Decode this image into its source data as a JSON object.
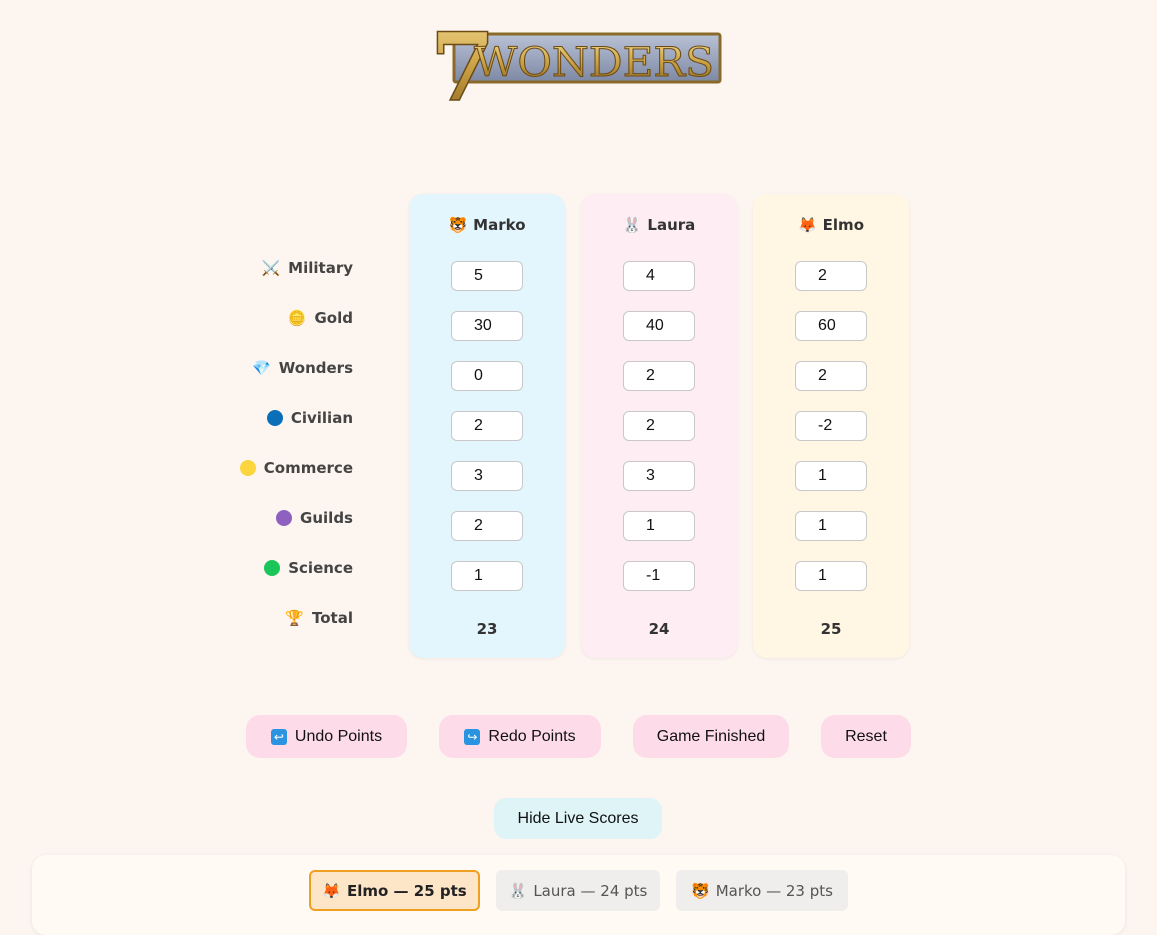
{
  "logo": {
    "text_digit": "7",
    "text_word": "WONDERS"
  },
  "categories": [
    {
      "label": "Military",
      "icon": "crossed-swords-icon"
    },
    {
      "label": "Gold",
      "icon": "coin-icon",
      "color": "#e8a020"
    },
    {
      "label": "Wonders",
      "icon": "gem-icon"
    },
    {
      "label": "Civilian",
      "icon": "blue-circle-icon",
      "color": "#0a6fb8"
    },
    {
      "label": "Commerce",
      "icon": "yellow-circle-icon",
      "color": "#fcd53f"
    },
    {
      "label": "Guilds",
      "icon": "purple-circle-icon",
      "color": "#8e61c0"
    },
    {
      "label": "Science",
      "icon": "green-circle-icon",
      "color": "#1ac65a"
    },
    {
      "label": "Total",
      "icon": "trophy-icon"
    }
  ],
  "players": [
    {
      "name": "Marko",
      "emoji": "🐯",
      "card_color": "#e3f5fd",
      "scores": [
        "5",
        "30",
        "0",
        "2",
        "3",
        "2",
        "1"
      ],
      "total": "23"
    },
    {
      "name": "Laura",
      "emoji": "🐰",
      "card_color": "#feedf3",
      "scores": [
        "4",
        "40",
        "2",
        "2",
        "3",
        "1",
        "-1"
      ],
      "total": "24"
    },
    {
      "name": "Elmo",
      "emoji": "🦊",
      "card_color": "#fff7e4",
      "scores": [
        "2",
        "60",
        "2",
        "-2",
        "1",
        "1",
        "1"
      ],
      "total": "25"
    }
  ],
  "buttons": {
    "undo": "Undo Points",
    "redo": "Redo Points",
    "finished": "Game Finished",
    "reset": "Reset",
    "live": "Hide Live Scores"
  },
  "leaderboard": [
    {
      "emoji": "🦊",
      "text": "Elmo — 25 pts"
    },
    {
      "emoji": "🐰",
      "text": "Laura — 24 pts"
    },
    {
      "emoji": "🐯",
      "text": "Marko — 23 pts"
    }
  ]
}
